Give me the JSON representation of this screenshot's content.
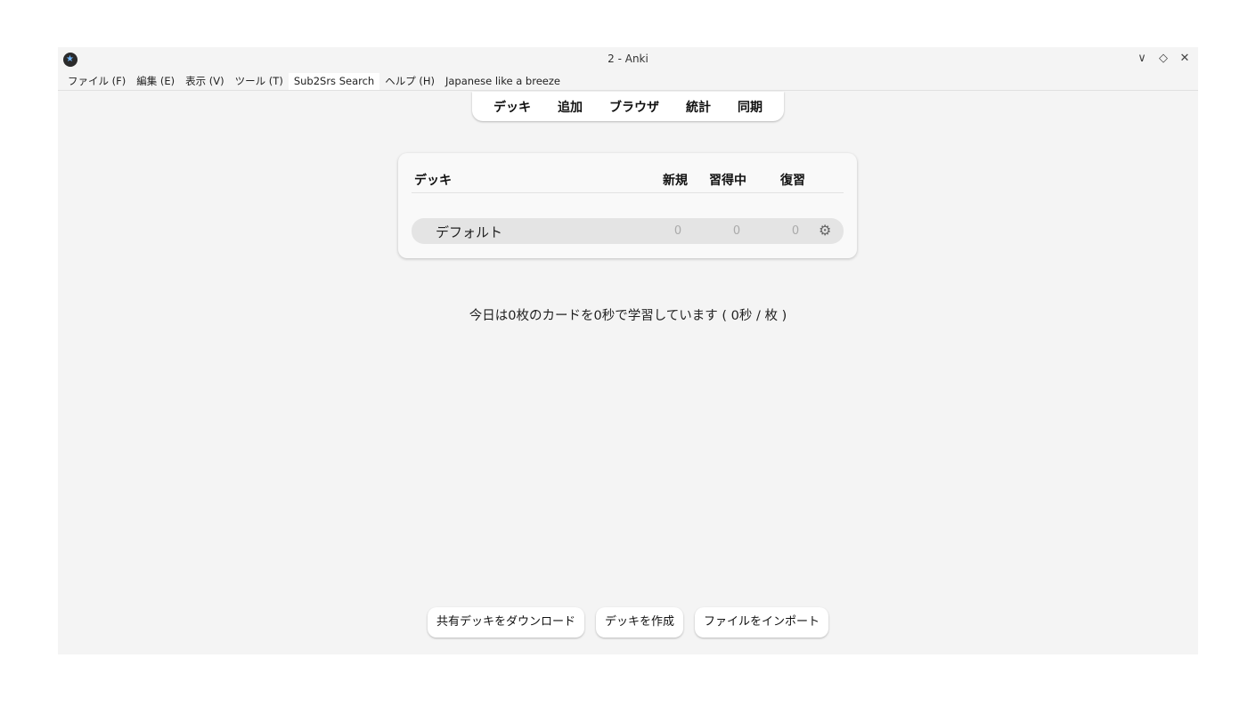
{
  "window": {
    "title": "2 - Anki",
    "controls": [
      "∨",
      "◇",
      "✕"
    ]
  },
  "menu": [
    "ファイル (F)",
    "編集 (E)",
    "表示 (V)",
    "ツール (T)",
    "Sub2Srs Search",
    "ヘルプ (H)",
    "Japanese like a breeze"
  ],
  "toolbar": {
    "decks": "デッキ",
    "add": "追加",
    "browse": "ブラウザ",
    "stats": "統計",
    "sync": "同期"
  },
  "deck_table": {
    "headers": {
      "deck": "デッキ",
      "new": "新規",
      "learning": "習得中",
      "review": "復習"
    },
    "rows": [
      {
        "name": "デフォルト",
        "new": "0",
        "learning": "0",
        "review": "0"
      }
    ]
  },
  "study_summary": "今日は0枚のカードを0秒で学習しています ( 0秒 / 枚 )",
  "bottom_buttons": {
    "shared": "共有デッキをダウンロード",
    "create": "デッキを作成",
    "import": "ファイルをインポート"
  }
}
